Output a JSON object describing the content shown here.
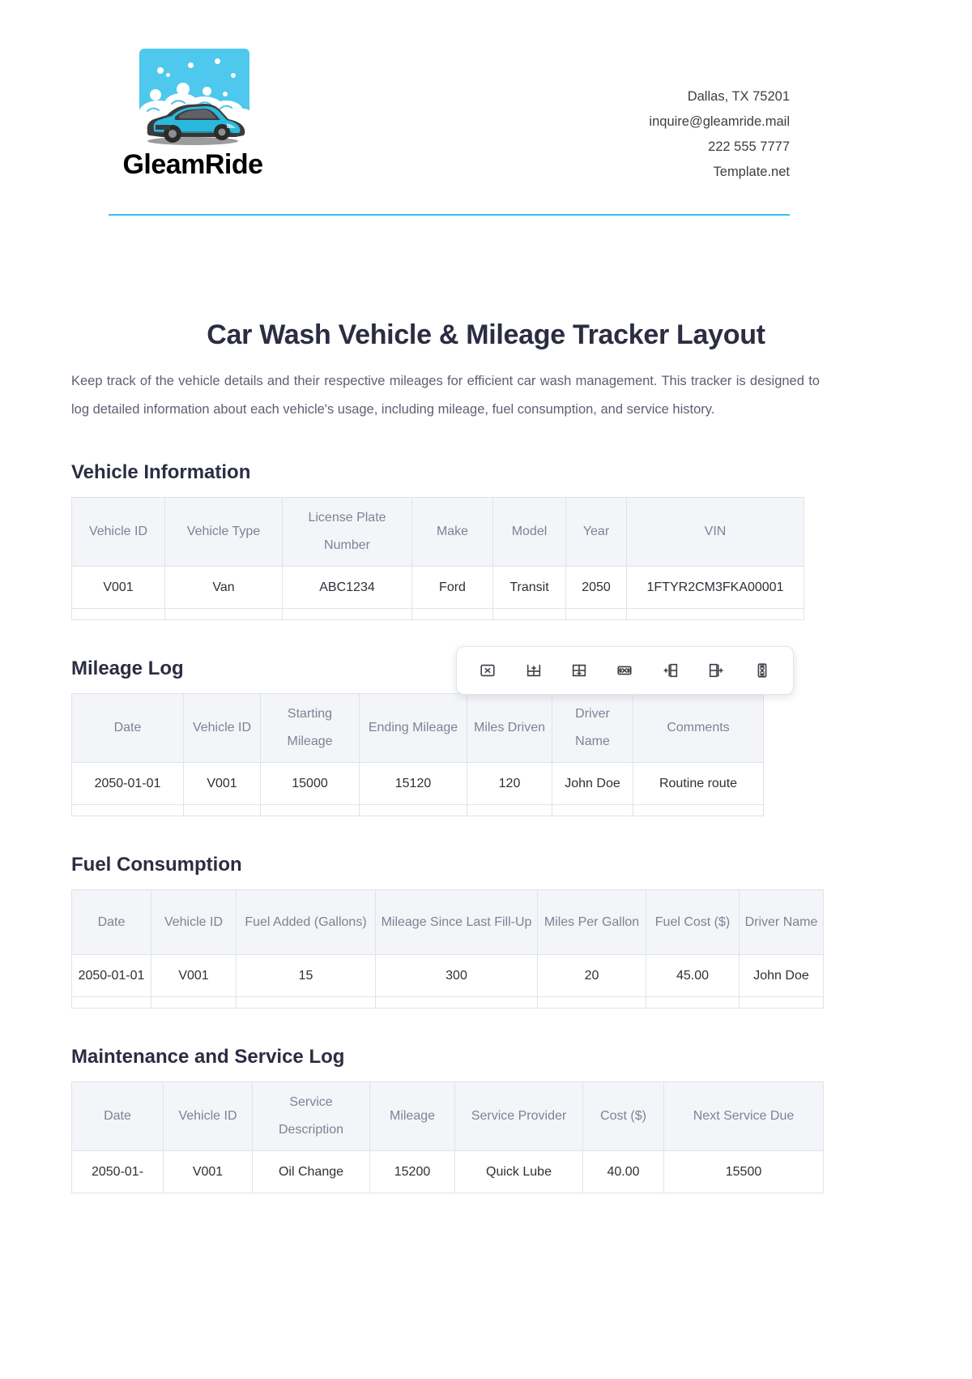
{
  "brand": {
    "name": "GleamRide",
    "logo_icon": "car-wash-logo-icon"
  },
  "contact": {
    "address": "Dallas, TX 75201",
    "email": "inquire@gleamride.mail",
    "phone": "222 555 7777",
    "website": "Template.net"
  },
  "document": {
    "title": "Car Wash Vehicle & Mileage Tracker Layout",
    "description": "Keep track of the vehicle details and their respective mileages for efficient car wash management. This tracker is designed to log detailed information about each vehicle's usage, including mileage, fuel consumption, and service history."
  },
  "colors": {
    "accent": "#2ec4f1",
    "logo_sky": "#4ec8ec",
    "heading": "#2b2d42",
    "body_text": "#5e6073",
    "table_header_bg": "#f3f5f9",
    "table_header_text": "#7d8396",
    "table_border": "#dfe3ea"
  },
  "sections": [
    {
      "title": "Vehicle Information",
      "columns": [
        "Vehicle ID",
        "Vehicle Type",
        "License Plate Number",
        "Make",
        "Model",
        "Year",
        "VIN"
      ],
      "rows": [
        [
          "V001",
          "Van",
          "ABC1234",
          "Ford",
          "Transit",
          "2050",
          "1FTYR2CM3FKA00001"
        ]
      ]
    },
    {
      "title": "Mileage Log",
      "columns": [
        "Date",
        "Vehicle ID",
        "Starting Mileage",
        "Ending Mileage",
        "Miles Driven",
        "Driver Name",
        "Comments"
      ],
      "rows": [
        [
          "2050-01-01",
          "V001",
          "15000",
          "15120",
          "120",
          "John Doe",
          "Routine route"
        ]
      ]
    },
    {
      "title": "Fuel Consumption",
      "columns": [
        "Date",
        "Vehicle ID",
        "Fuel Added (Gallons)",
        "Mileage Since Last Fill-Up",
        "Miles Per Gallon",
        "Fuel Cost ($)",
        "Driver Name"
      ],
      "rows": [
        [
          "2050-01-01",
          "V001",
          "15",
          "300",
          "20",
          "45.00",
          "John Doe"
        ]
      ]
    },
    {
      "title": "Maintenance and Service Log",
      "columns": [
        "Date",
        "Vehicle ID",
        "Service Description",
        "Mileage",
        "Service Provider",
        "Cost ($)",
        "Next Service Due"
      ],
      "rows": [
        [
          "2050-01-",
          "V001",
          "Oil Change",
          "15200",
          "Quick Lube",
          "40.00",
          "15500"
        ]
      ]
    }
  ],
  "table_toolbar": {
    "buttons": [
      {
        "name": "delete-table-button",
        "icon": "table-delete-icon",
        "label": "Delete table"
      },
      {
        "name": "insert-row-above-button",
        "icon": "row-insert-above-icon",
        "label": "Insert row above"
      },
      {
        "name": "insert-row-below-button",
        "icon": "row-insert-below-icon",
        "label": "Insert row below"
      },
      {
        "name": "delete-row-button",
        "icon": "row-delete-icon",
        "label": "Delete row"
      },
      {
        "name": "insert-column-left-button",
        "icon": "column-insert-left-icon",
        "label": "Insert column left"
      },
      {
        "name": "insert-column-right-button",
        "icon": "column-insert-right-icon",
        "label": "Insert column right"
      },
      {
        "name": "delete-column-button",
        "icon": "column-delete-icon",
        "label": "Delete column"
      }
    ]
  }
}
